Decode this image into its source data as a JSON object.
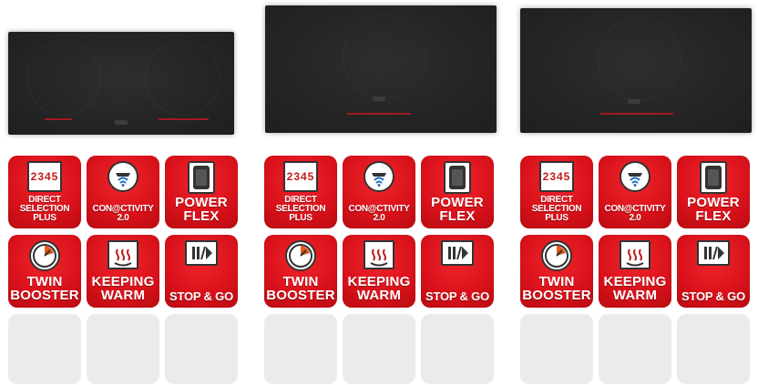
{
  "products": [
    {
      "features": [
        {
          "label": "DIRECT\nSELECTION PLUS",
          "icon": "display-digits-icon",
          "icon_text": "2345"
        },
        {
          "label": "CON@CTIVITY\n2.0",
          "icon": "hood-wifi-icon"
        },
        {
          "label": "POWER\nFLEX",
          "icon": "flex-zone-icon"
        },
        {
          "label": "TWIN\nBOOSTER",
          "icon": "timer-dial-icon"
        },
        {
          "label": "KEEPING\nWARM",
          "icon": "keep-warm-icon"
        },
        {
          "label": "STOP & GO",
          "icon": "pause-play-icon"
        }
      ]
    },
    {
      "features": [
        {
          "label": "DIRECT\nSELECTION PLUS",
          "icon": "display-digits-icon",
          "icon_text": "2345"
        },
        {
          "label": "CON@CTIVITY\n2.0",
          "icon": "hood-wifi-icon"
        },
        {
          "label": "POWER\nFLEX",
          "icon": "flex-zone-icon"
        },
        {
          "label": "TWIN\nBOOSTER",
          "icon": "timer-dial-icon"
        },
        {
          "label": "KEEPING\nWARM",
          "icon": "keep-warm-icon"
        },
        {
          "label": "STOP & GO",
          "icon": "pause-play-icon"
        }
      ]
    },
    {
      "features": [
        {
          "label": "DIRECT\nSELECTION PLUS",
          "icon": "display-digits-icon",
          "icon_text": "2345"
        },
        {
          "label": "CON@CTIVITY\n2.0",
          "icon": "hood-wifi-icon"
        },
        {
          "label": "POWER\nFLEX",
          "icon": "flex-zone-icon"
        },
        {
          "label": "TWIN\nBOOSTER",
          "icon": "timer-dial-icon"
        },
        {
          "label": "KEEPING\nWARM",
          "icon": "keep-warm-icon"
        },
        {
          "label": "STOP & GO",
          "icon": "pause-play-icon"
        }
      ]
    }
  ],
  "colors": {
    "badge_red": "#d8111a",
    "empty_tile": "#ebebeb",
    "cooktop": "#252525"
  }
}
